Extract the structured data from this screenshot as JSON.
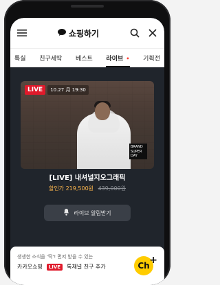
{
  "header": {
    "title": "쇼핑하기",
    "icons": {
      "menu": "hamburger-menu-icon",
      "brand": "chat-bubble-icon",
      "search": "search-icon",
      "close": "close-icon"
    }
  },
  "tabs": [
    {
      "label": "특실"
    },
    {
      "label": "친구세딱"
    },
    {
      "label": "베스트"
    },
    {
      "label": "라이브",
      "active": true,
      "dot": "•"
    },
    {
      "label": "기획전"
    }
  ],
  "live": {
    "badge": "LIVE",
    "time": "10.27 月 19:30",
    "brand_tag_lines": [
      "BRAND",
      "SUPER",
      "DAY"
    ]
  },
  "product": {
    "title": "[LIVE] 내셔널지오그래픽",
    "sale_price": "할인가 219,500원",
    "original_price": "439,000원"
  },
  "alarm_button": {
    "label": "라이브 알림받기",
    "icon": "bell-icon"
  },
  "promo": {
    "line1": "생생한 소식을 '딱'! 먼저 받을 수 있는",
    "prefix": "카카오쇼핑",
    "live_badge": "LIVE",
    "line2_suffix": "톡채널 친구 추가",
    "ch_badge": "Ch",
    "plus": "+"
  },
  "colors": {
    "live_red": "#e01a2b",
    "sale_orange": "#ffb84d",
    "channel_yellow": "#ffcc00"
  }
}
